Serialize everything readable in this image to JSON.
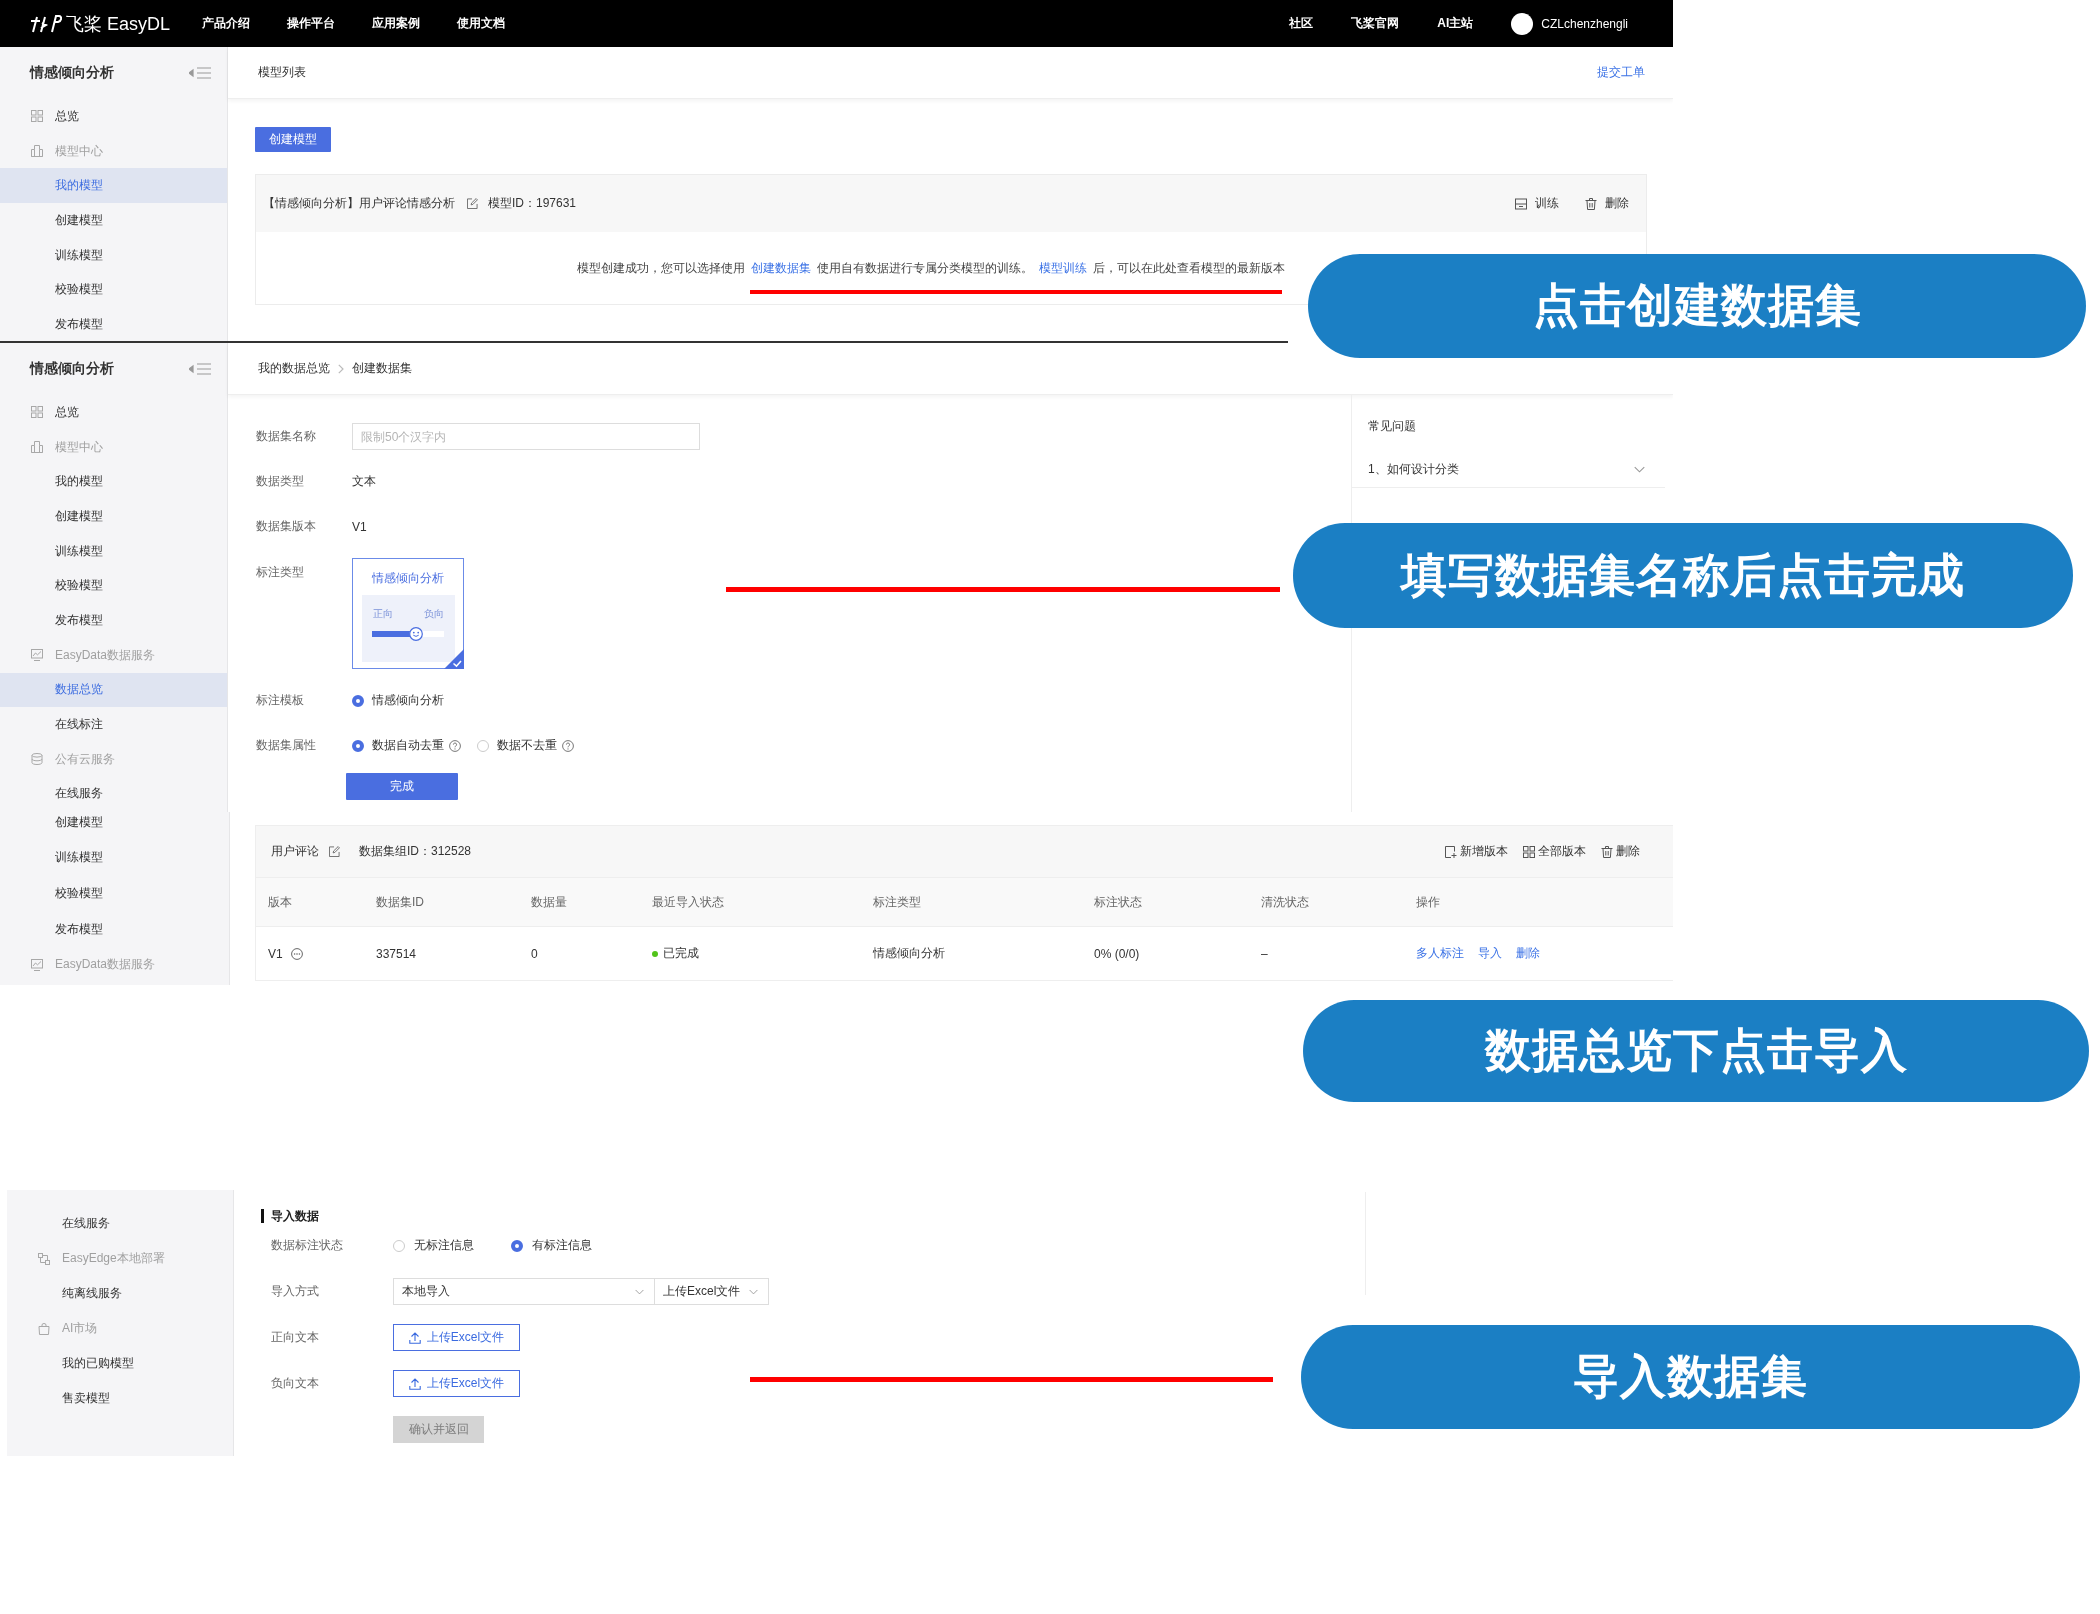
{
  "top_nav": {
    "logo": "飞桨 EasyDL",
    "menu": [
      "产品介绍",
      "操作平台",
      "应用案例",
      "使用文档"
    ],
    "links": [
      "社区",
      "飞桨官网",
      "AI主站"
    ],
    "user": "CZLchenzhengli"
  },
  "model_list_screen": {
    "sidebar": {
      "title": "情感倾向分析",
      "items": [
        {
          "label": "总览",
          "kind": "overview",
          "selected": false
        },
        {
          "label": "模型中心",
          "kind": "models",
          "selected": false
        },
        {
          "label": "我的模型",
          "kind": "page",
          "selected": true
        },
        {
          "label": "创建模型",
          "kind": "page",
          "selected": false
        },
        {
          "label": "训练模型",
          "kind": "page",
          "selected": false
        },
        {
          "label": "校验模型",
          "kind": "page",
          "selected": false
        },
        {
          "label": "发布模型",
          "kind": "page",
          "selected": false
        }
      ]
    },
    "header": {
      "title": "模型列表",
      "link": "提交工单"
    },
    "create_button": "创建模型",
    "model_card": {
      "title": "【情感倾向分析】用户评论情感分析",
      "model_id": "模型ID：197631",
      "actions": [
        {
          "label": "训练",
          "kind": "train"
        },
        {
          "label": "删除",
          "kind": "delete"
        }
      ],
      "message": [
        {
          "text": "模型创建成功，您可以选择使用",
          "kind": "text"
        },
        {
          "text": "创建数据集",
          "kind": "link"
        },
        {
          "text": "使用自有数据进行专属分类模型的训练。",
          "kind": "text"
        },
        {
          "text": "模型训练",
          "kind": "link"
        },
        {
          "text": "后，可以在此处查看模型的最新版本",
          "kind": "text"
        }
      ]
    }
  },
  "create_dataset_screen": {
    "sidebar": {
      "title": "情感倾向分析",
      "items": [
        {
          "label": "总览",
          "kind": "overview",
          "selected": false
        },
        {
          "label": "模型中心",
          "kind": "models",
          "selected": false
        },
        {
          "label": "我的模型",
          "kind": "page",
          "selected": false
        },
        {
          "label": "创建模型",
          "kind": "page",
          "selected": false
        },
        {
          "label": "训练模型",
          "kind": "page",
          "selected": false
        },
        {
          "label": "校验模型",
          "kind": "page",
          "selected": false
        },
        {
          "label": "发布模型",
          "kind": "page",
          "selected": false
        },
        {
          "label": "EasyData数据服务",
          "kind": "data",
          "selected": false
        },
        {
          "label": "数据总览",
          "kind": "page",
          "selected": true
        },
        {
          "label": "在线标注",
          "kind": "page",
          "selected": false
        },
        {
          "label": "公有云服务",
          "kind": "cloud",
          "selected": false
        },
        {
          "label": "在线服务",
          "kind": "page",
          "selected": false
        }
      ]
    },
    "breadcrumb": [
      "我的数据总览",
      "创建数据集"
    ],
    "form": {
      "rows": [
        {
          "label": "数据集名称",
          "kind": "input",
          "placeholder": "限制50个汉字内"
        },
        {
          "label": "数据类型",
          "kind": "text",
          "value": "文本"
        },
        {
          "label": "数据集版本",
          "kind": "text",
          "value": "V1"
        },
        {
          "label": "标注类型",
          "kind": "card",
          "card": {
            "title": "情感倾向分析",
            "labels": [
              "正向",
              "负向"
            ],
            "selected": true
          }
        },
        {
          "label": "标注模板",
          "kind": "radio",
          "options": [
            {
              "label": "情感倾向分析",
              "selected": true,
              "help": false
            }
          ]
        },
        {
          "label": "数据集属性",
          "kind": "radio",
          "options": [
            {
              "label": "数据自动去重",
              "selected": true,
              "help": true
            },
            {
              "label": "数据不去重",
              "selected": false,
              "help": true
            }
          ]
        }
      ],
      "submit": "完成"
    },
    "faq": {
      "title": "常见问题",
      "items": [
        {
          "label": "1、如何设计分类",
          "expanded": false
        }
      ]
    }
  },
  "dataset_list_screen": {
    "sidebar": {
      "items": [
        {
          "label": "创建模型",
          "kind": "page",
          "selected": false
        },
        {
          "label": "训练模型",
          "kind": "page",
          "selected": false
        },
        {
          "label": "校验模型",
          "kind": "page",
          "selected": false
        },
        {
          "label": "发布模型",
          "kind": "page",
          "selected": false
        },
        {
          "label": "EasyData数据服务",
          "kind": "data",
          "selected": false
        }
      ]
    },
    "group": {
      "name": "用户评论",
      "group_id": "数据集组ID：312528",
      "actions": [
        {
          "label": "新增版本",
          "kind": "add"
        },
        {
          "label": "全部版本",
          "kind": "all"
        },
        {
          "label": "删除",
          "kind": "delete"
        }
      ]
    },
    "table": {
      "columns": [
        "版本",
        "数据集ID",
        "数据量",
        "最近导入状态",
        "标注类型",
        "标注状态",
        "清洗状态",
        "操作"
      ],
      "rows": [
        {
          "version": "V1",
          "dataset_id": "337514",
          "count": "0",
          "import_status": {
            "text": "已完成",
            "color": "#52c41a"
          },
          "label_type": "情感倾向分析",
          "label_status": "0% (0/0)",
          "clean_status": "–",
          "actions": [
            "多人标注",
            "导入",
            "删除"
          ]
        }
      ]
    }
  },
  "import_screen": {
    "sidebar": {
      "items": [
        {
          "label": "在线服务",
          "kind": "page",
          "selected": false
        },
        {
          "label": "EasyEdge本地部署",
          "kind": "edge",
          "selected": false
        },
        {
          "label": "纯离线服务",
          "kind": "page",
          "selected": false
        },
        {
          "label": "AI市场",
          "kind": "market",
          "selected": false
        },
        {
          "label": "我的已购模型",
          "kind": "page",
          "selected": false
        },
        {
          "label": "售卖模型",
          "kind": "page",
          "selected": false
        }
      ]
    },
    "title": "导入数据",
    "rows": [
      {
        "label": "数据标注状态",
        "kind": "radio",
        "options": [
          {
            "label": "无标注信息",
            "selected": false
          },
          {
            "label": "有标注信息",
            "selected": true
          }
        ]
      },
      {
        "label": "导入方式",
        "kind": "select",
        "selects": [
          "本地导入",
          "上传Excel文件"
        ]
      },
      {
        "label": "正向文本",
        "kind": "upload",
        "button": "上传Excel文件"
      },
      {
        "label": "负向文本",
        "kind": "upload",
        "button": "上传Excel文件"
      }
    ],
    "submit": {
      "label": "确认并返回",
      "disabled": true
    }
  },
  "callouts": [
    "点击创建数据集",
    "填写数据集名称后点击完成",
    "数据总览下点击导入",
    "导入数据集"
  ]
}
